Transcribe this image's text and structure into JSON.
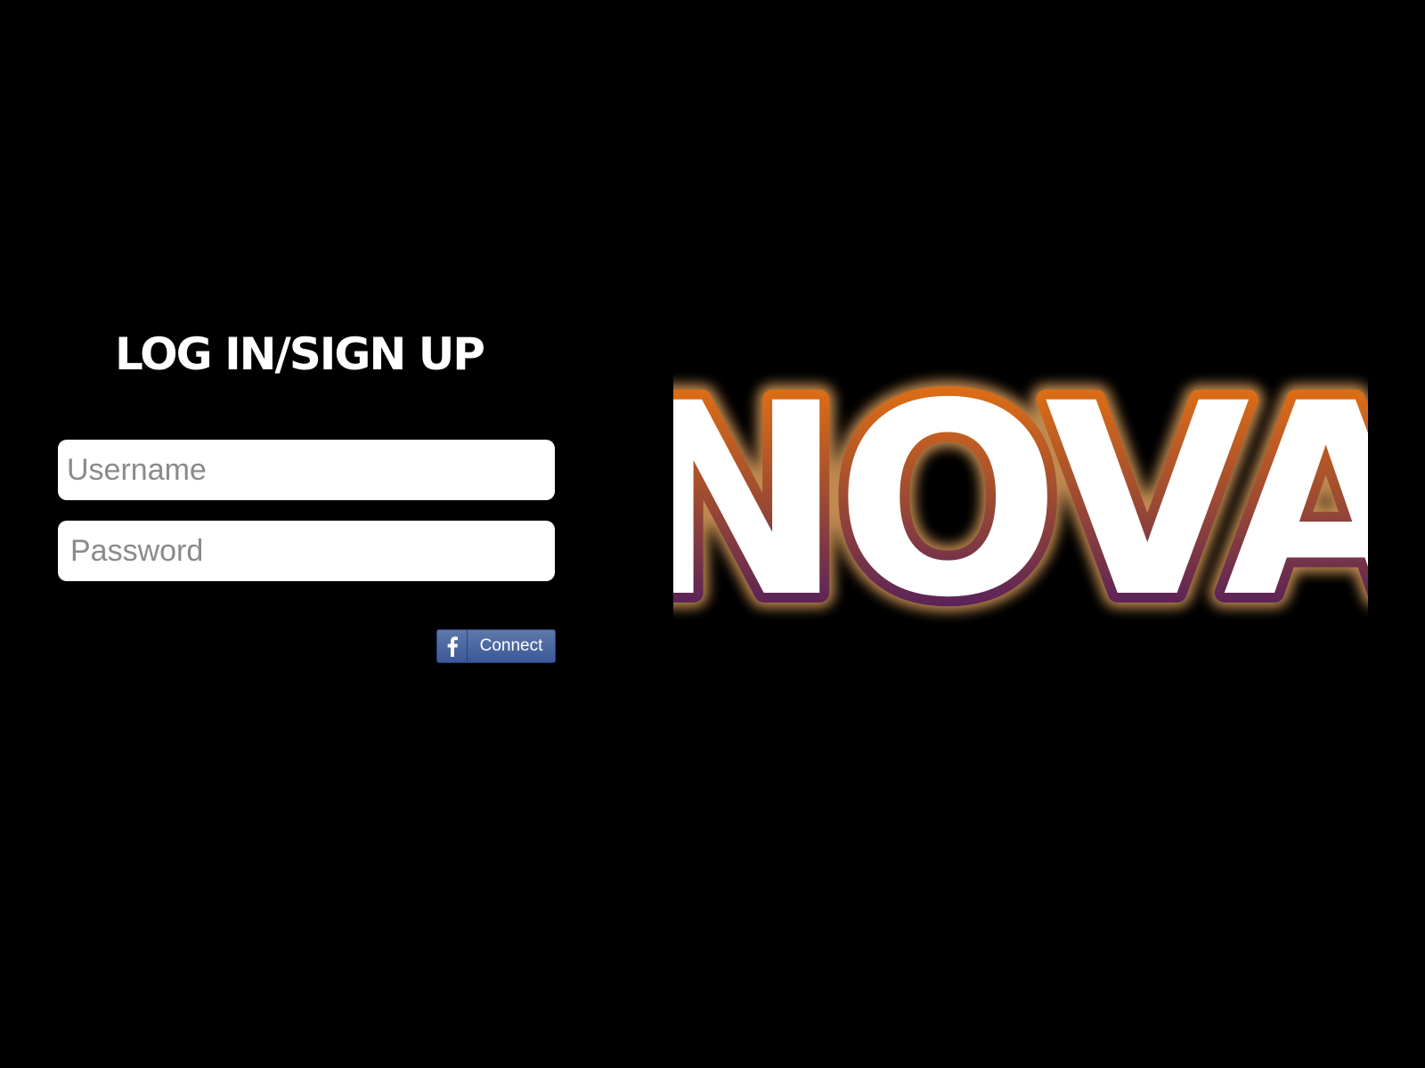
{
  "login": {
    "title": "LOG IN/SIGN UP",
    "username_placeholder": "Username",
    "password_placeholder": "Password",
    "facebook_button": {
      "label": "Connect",
      "icon": "facebook-f-icon"
    }
  },
  "brand": {
    "logo_text": "NOVA",
    "colors": {
      "outline_top": "#f57b0a",
      "outline_bottom": "#3a0f6b",
      "letter_fill": "#ffffff",
      "glow": "#ffb86a"
    }
  },
  "colors": {
    "background": "#000000",
    "facebook_blue": "#3b5998"
  }
}
